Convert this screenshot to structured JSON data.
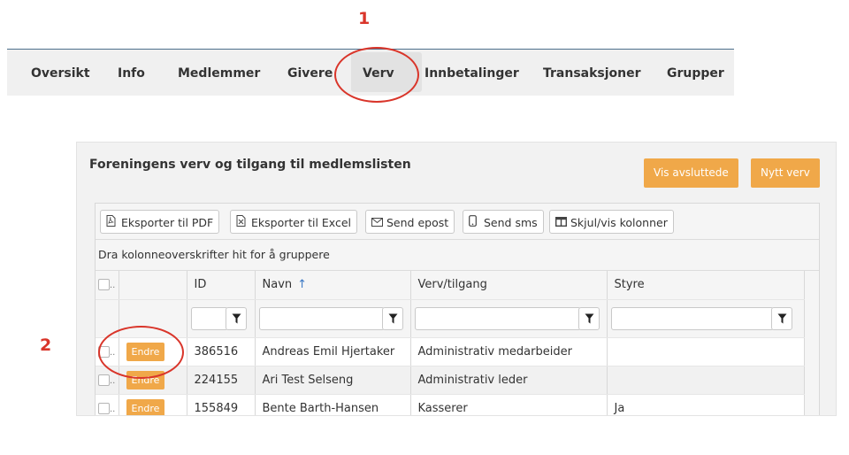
{
  "annotations": {
    "marker1": "1",
    "marker2": "2"
  },
  "nav": {
    "items": [
      {
        "label": "Oversikt"
      },
      {
        "label": "Info"
      },
      {
        "label": "Medlemmer"
      },
      {
        "label": "Givere"
      },
      {
        "label": "Verv"
      },
      {
        "label": "Innbetalinger"
      },
      {
        "label": "Transaksjoner"
      },
      {
        "label": "Grupper"
      }
    ],
    "active": "Verv"
  },
  "panel": {
    "title": "Foreningens verv og tilgang til medlemslisten",
    "btn_vis_avsluttede": "Vis avsluttede",
    "btn_nytt_verv": "Nytt verv"
  },
  "toolbar": {
    "export_pdf": "Eksporter til PDF",
    "export_excel": "Eksporter til Excel",
    "send_epost": "Send epost",
    "send_sms": "Send sms",
    "toggle_columns": "Skjul/vis kolonner"
  },
  "grid": {
    "group_hint": "Dra kolonneoverskrifter hit for å gruppere",
    "columns": {
      "id": "ID",
      "navn": "Navn",
      "verv": "Verv/tilgang",
      "styre": "Styre"
    },
    "sort_indicator": "↑",
    "edit_label": "Endre",
    "rows": [
      {
        "id": "386516",
        "navn": "Andreas Emil Hjertaker",
        "verv": "Administrativ medarbeider",
        "styre": ""
      },
      {
        "id": "224155",
        "navn": "Ari Test Selseng",
        "verv": "Administrativ leder",
        "styre": ""
      },
      {
        "id": "155849",
        "navn": "Bente Barth-Hansen",
        "verv": "Kasserer",
        "styre": "Ja"
      }
    ]
  },
  "colors": {
    "accent_orange": "#f0a849",
    "annotation_red": "#d9352a",
    "nav_border": "#4d6f8c"
  }
}
